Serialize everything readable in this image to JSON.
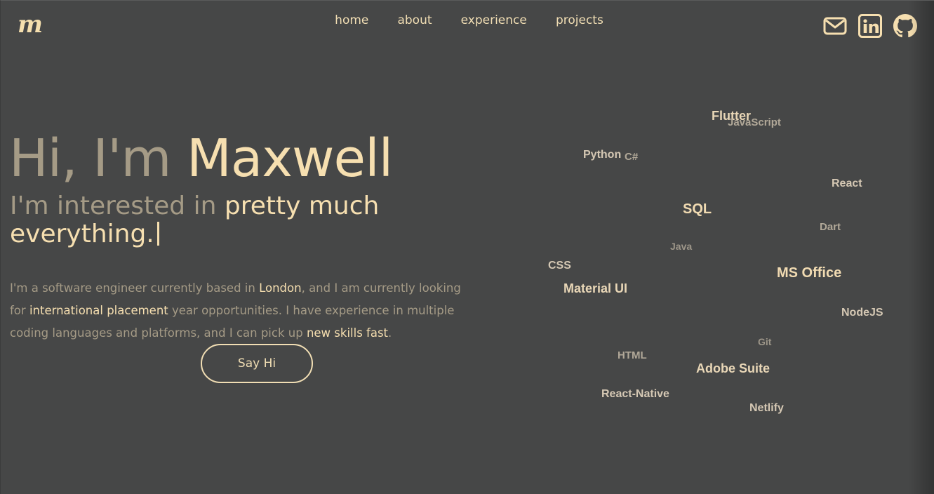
{
  "brand": {
    "logo_text": "m"
  },
  "nav": {
    "items": [
      {
        "label": "home"
      },
      {
        "label": "about"
      },
      {
        "label": "experience"
      },
      {
        "label": "projects"
      }
    ]
  },
  "socials": [
    {
      "icon": "mail-icon"
    },
    {
      "icon": "linkedin-icon"
    },
    {
      "icon": "github-icon"
    }
  ],
  "hero": {
    "greeting": "Hi, I'm",
    "name": "Maxwell",
    "interest_prefix": "I'm interested in",
    "interest_typed": "pretty much everything."
  },
  "bio": {
    "p1": "I'm a software engineer currently based in ",
    "h1": "London",
    "p2": ", and I am currently looking for ",
    "h2": "international placement",
    "p3": " year opportunities. I have experience in multiple coding languages and platforms, and I can pick up ",
    "h3": "new skills fast",
    "p4": "."
  },
  "cta": {
    "label": "Say Hi"
  },
  "skills": {
    "flutter": "Flutter",
    "javascript": "JavaScript",
    "python": "Python",
    "csharp": "C#",
    "react": "React",
    "sql": "SQL",
    "dart": "Dart",
    "java": "Java",
    "css": "CSS",
    "ms_office": "MS Office",
    "material_ui": "Material UI",
    "nodejs": "NodeJS",
    "git": "Git",
    "html": "HTML",
    "adobe_suite": "Adobe Suite",
    "react_native": "React-Native",
    "netlify": "Netlify"
  },
  "colors": {
    "background": "#464747",
    "accent": "#f6dfb0",
    "muted": "#a59b86"
  }
}
